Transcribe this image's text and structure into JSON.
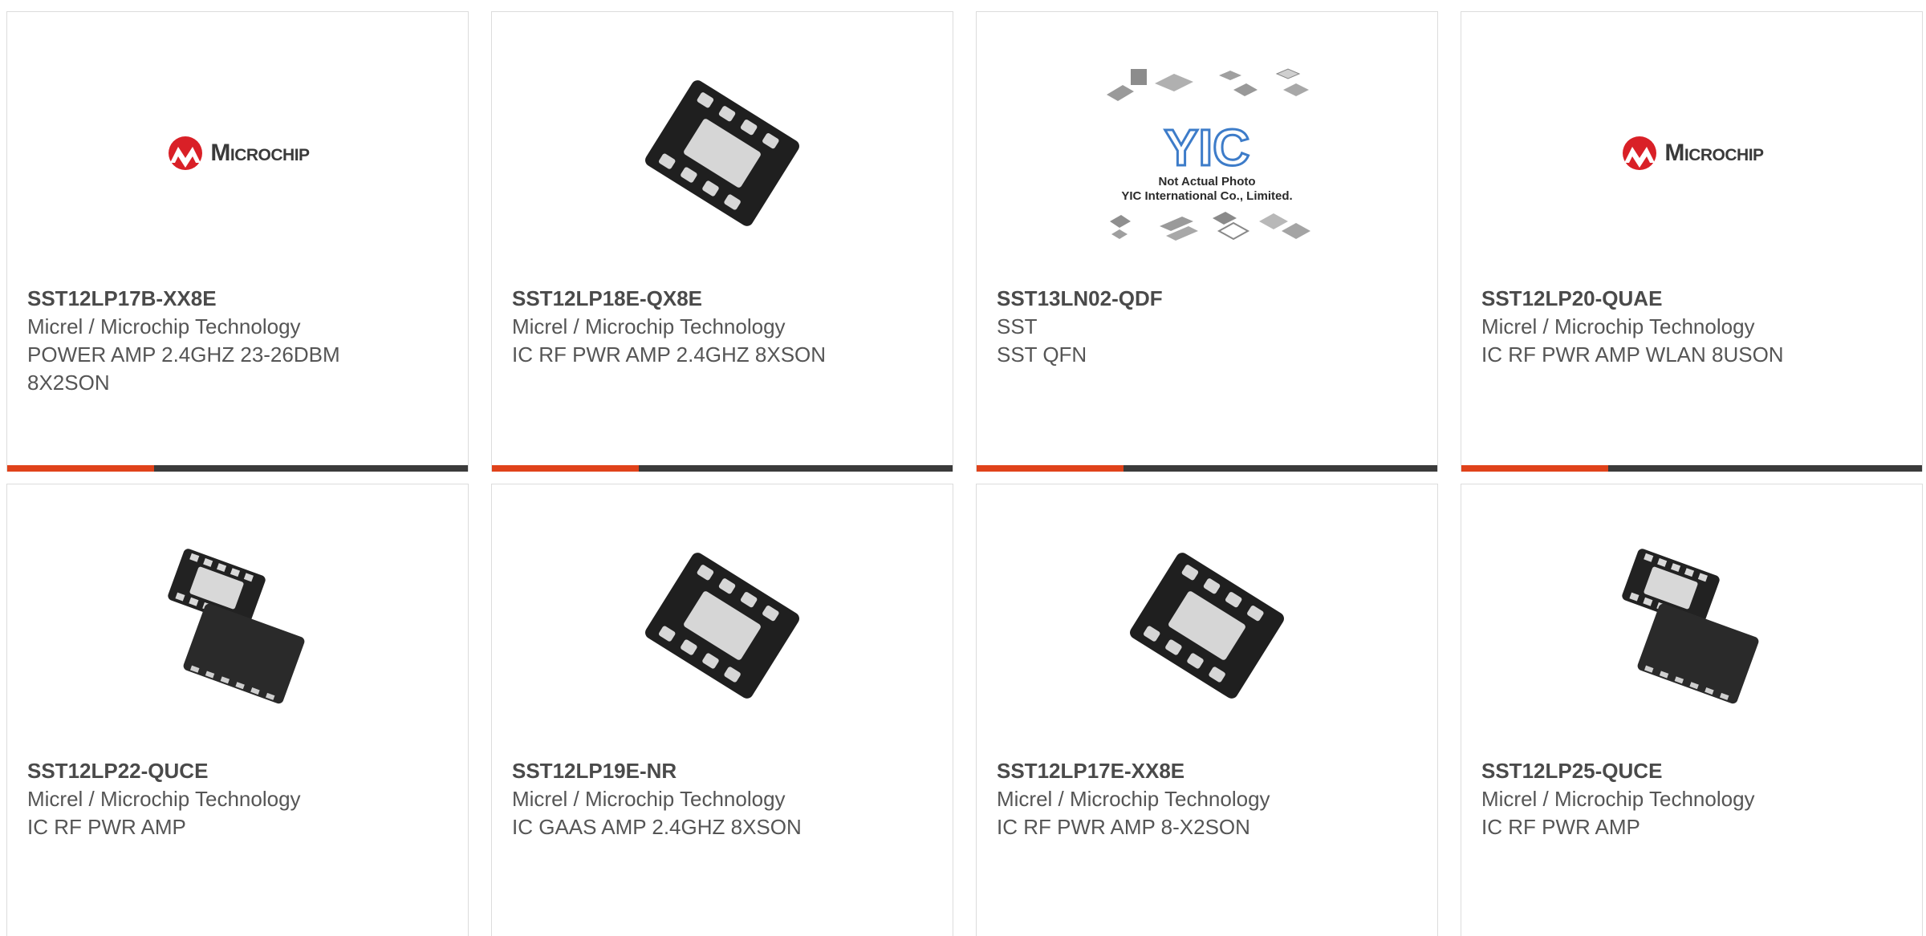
{
  "colors": {
    "accent": "#e0421a",
    "bar": "#3b3b3b",
    "border": "#dcdcdc",
    "text": "#555555",
    "brand_red": "#d92027"
  },
  "products": [
    {
      "part_number": "SST12LP17B-XX8E",
      "manufacturer": "Micrel / Microchip Technology",
      "description": "POWER AMP 2.4GHZ 23-26DBM 8X2SON",
      "image": "microchip-logo",
      "logo_text": "Microchip"
    },
    {
      "part_number": "SST12LP18E-QX8E",
      "manufacturer": "Micrel / Microchip Technology",
      "description": "IC RF PWR AMP 2.4GHZ 8XSON",
      "image": "son8-chip-icon"
    },
    {
      "part_number": "SST13LN02-QDF",
      "manufacturer": "SST",
      "description": "SST QFN",
      "image": "yic-placeholder",
      "logo_text": "YIC",
      "caption_1": "Not Actual Photo",
      "caption_2": "YIC International Co., Limited."
    },
    {
      "part_number": "SST12LP20-QUAE",
      "manufacturer": "Micrel / Microchip Technology",
      "description": "IC RF PWR AMP WLAN 8USON",
      "image": "microchip-logo",
      "logo_text": "Microchip"
    },
    {
      "part_number": "SST12LP22-QUCE",
      "manufacturer": "Micrel / Microchip Technology",
      "description": "IC RF PWR AMP",
      "image": "qfn16-chip-icon"
    },
    {
      "part_number": "SST12LP19E-NR",
      "manufacturer": "Micrel / Microchip Technology",
      "description": "IC GAAS AMP 2.4GHZ 8XSON",
      "image": "son8-chip-icon"
    },
    {
      "part_number": "SST12LP17E-XX8E",
      "manufacturer": "Micrel / Microchip Technology",
      "description": "IC RF PWR AMP 8-X2SON",
      "image": "son8-chip-icon"
    },
    {
      "part_number": "SST12LP25-QUCE",
      "manufacturer": "Micrel / Microchip Technology",
      "description": "IC RF PWR AMP",
      "image": "qfn16-chip-icon"
    }
  ]
}
